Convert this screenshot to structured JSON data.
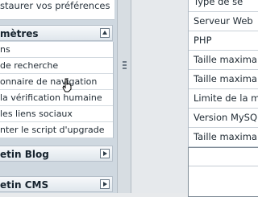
{
  "sidebar": {
    "restore_link": "staurer vos préférences",
    "settings_section": {
      "title": "mètres"
    },
    "menu_items": [
      {
        "label": "ns"
      },
      {
        "label": "de recherche"
      },
      {
        "label": "onnaire de navigation"
      },
      {
        "label": "la vérification humaine"
      },
      {
        "label": "les liens sociaux"
      },
      {
        "label": "nter le script d'upgrade"
      }
    ],
    "blog_section": {
      "title": "etin Blog"
    },
    "cms_section": {
      "title": "etin CMS"
    }
  },
  "info_panel": {
    "rows": [
      {
        "label": "Type de se"
      },
      {
        "label": "Serveur Web"
      },
      {
        "label": "PHP"
      },
      {
        "label": "Taille maxima"
      },
      {
        "label": "Taille maxima"
      },
      {
        "label": "Limite de la m"
      },
      {
        "label": "Version MySQ"
      },
      {
        "label": "Taille maxima"
      }
    ]
  }
}
